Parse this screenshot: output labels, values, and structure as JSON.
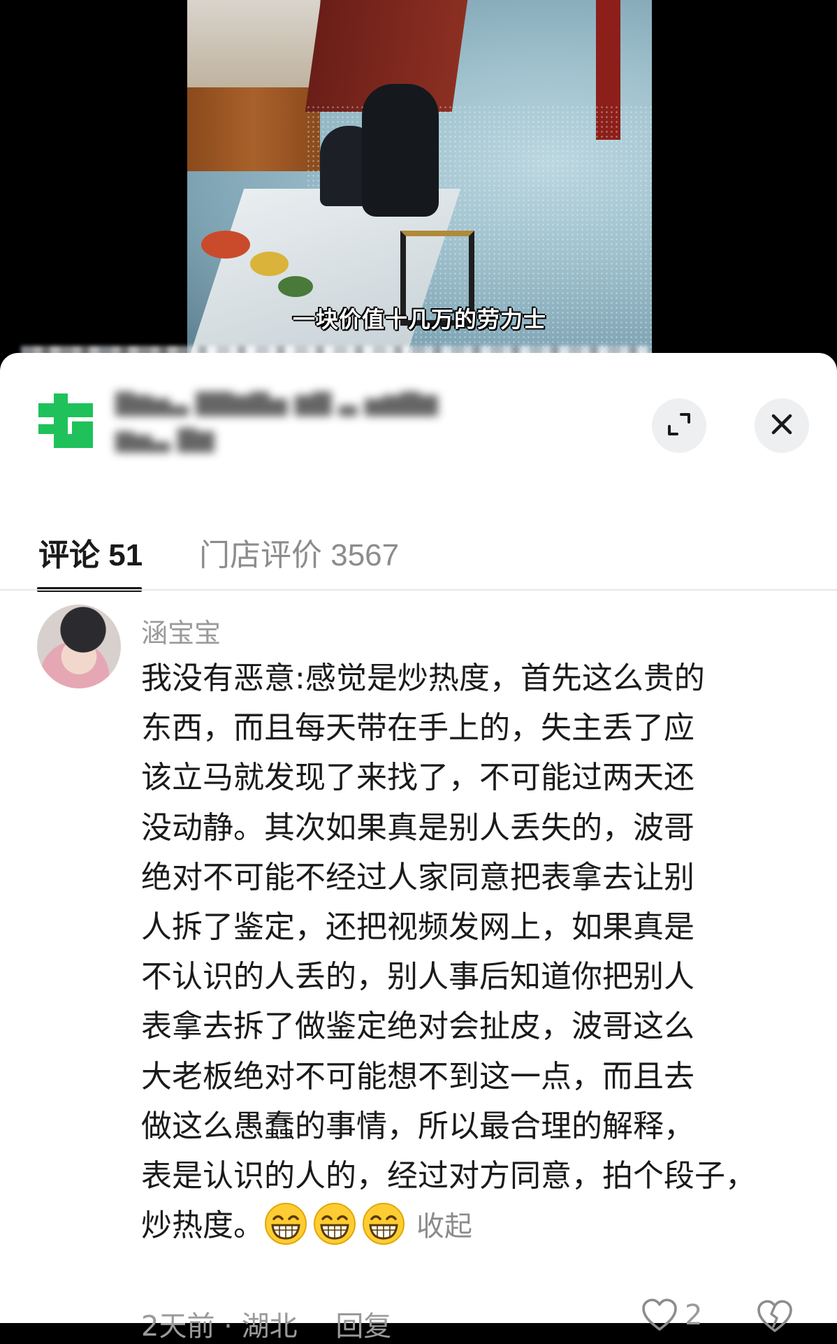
{
  "video": {
    "caption": "一块价值十几万的劳力士"
  },
  "sheet": {
    "shop_name_blurred": "▇▆▅▃ ▇▇▆▇▅ ▆▇ ▃ ▅▆▇▆",
    "shop_sub_blurred": "▆▅▃ ▇▆"
  },
  "tabs": [
    {
      "label": "评论 51"
    },
    {
      "label": "门店评价 3567"
    }
  ],
  "comment": {
    "username": "涵宝宝",
    "lines": [
      "我没有恶意:感觉是炒热度，首先这么贵的",
      "东西，而且每天带在手上的，失主丢了应",
      "该立马就发现了来找了，不可能过两天还",
      "没动静。其次如果真是别人丢失的，波哥",
      "绝对不可能不经过人家同意把表拿去让别",
      "人拆了鉴定，还把视频发网上，如果真是",
      "不认识的人丢的，别人事后知道你把别人",
      "表拿去拆了做鉴定绝对会扯皮，波哥这么",
      "大老板绝对不可能想不到这一点，而且去",
      "做这么愚蠢的事情，所以最合理的解释，",
      "表是认识的人的，经过对方同意，拍个段子，",
      "炒热度。"
    ],
    "emoji_icon": "grinning-face-icon",
    "collapse_label": "收起",
    "time": "2天前",
    "separator": "·",
    "location": "湖北",
    "reply_label": "回复",
    "like_count": "2"
  },
  "colors": {
    "accent_green": "#1fc15a",
    "text_primary": "#1a1a1a",
    "text_secondary": "#9a9a9a"
  }
}
